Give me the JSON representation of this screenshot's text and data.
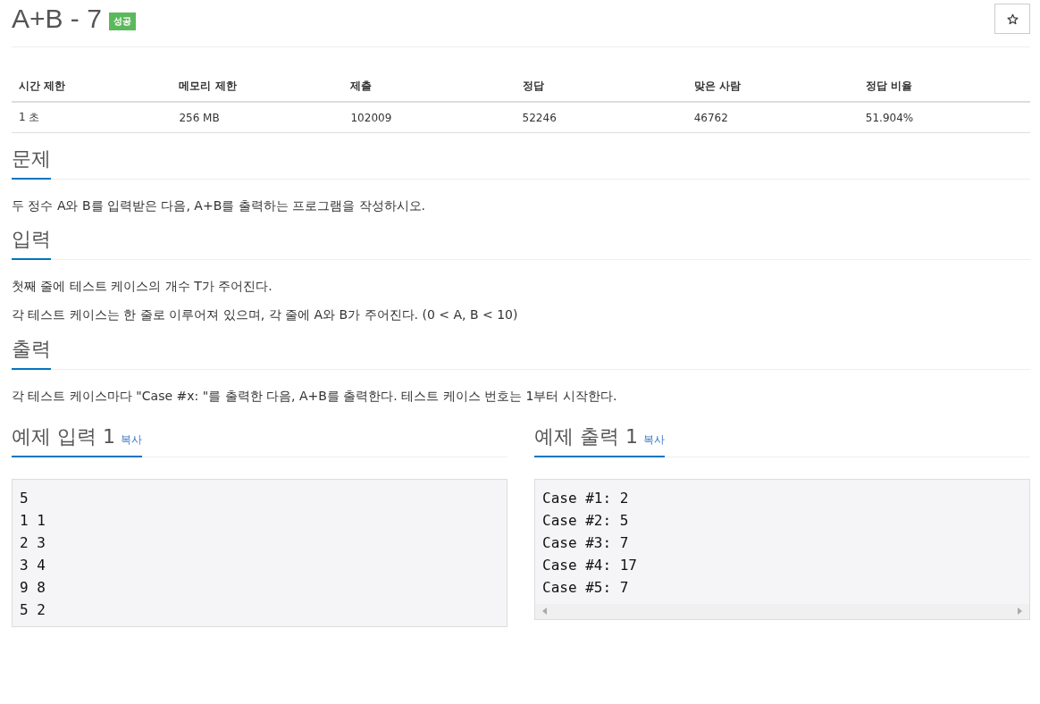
{
  "title": "A+B - 7",
  "badge": "성공",
  "info_table": {
    "columns": [
      "시간 제한",
      "메모리 제한",
      "제출",
      "정답",
      "맞은 사람",
      "정답 비율"
    ],
    "rows": [
      [
        "1 초",
        "256 MB",
        "102009",
        "52246",
        "46762",
        "51.904%"
      ]
    ]
  },
  "sections": [
    {
      "heading": "문제",
      "paragraphs": [
        "두 정수 A와 B를 입력받은 다음, A+B를 출력하는 프로그램을 작성하시오."
      ]
    },
    {
      "heading": "입력",
      "paragraphs": [
        "첫째 줄에 테스트 케이스의 개수 T가 주어진다.",
        "각 테스트 케이스는 한 줄로 이루어져 있으며, 각 줄에 A와 B가 주어진다. (0 < A, B < 10)"
      ]
    },
    {
      "heading": "출력",
      "paragraphs": [
        "각 테스트 케이스마다 \"Case #x: \"를 출력한 다음, A+B를 출력한다. 테스트 케이스 번호는 1부터 시작한다."
      ]
    }
  ],
  "samples": [
    {
      "heading": "예제 입력 1",
      "copy": "복사",
      "lines": [
        "5",
        "1 1",
        "2 3",
        "3 4",
        "9 8",
        "5 2"
      ]
    },
    {
      "heading": "예제 출력 1",
      "copy": "복사",
      "lines": [
        "Case #1: 2",
        "Case #2: 5",
        "Case #3: 7",
        "Case #4: 17",
        "Case #5: 7"
      ]
    }
  ]
}
